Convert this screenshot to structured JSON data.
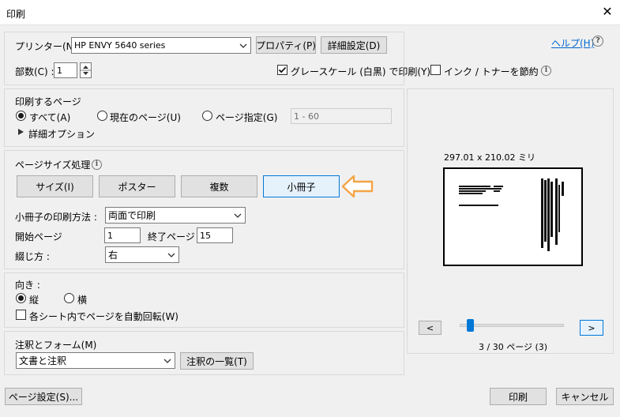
{
  "window": {
    "title": "印刷",
    "close_glyph": "✕"
  },
  "printer": {
    "label": "プリンター(N) :",
    "selected": "HP ENVY 5640 series",
    "properties_button": "プロパティ(P)",
    "advanced_button": "詳細設定(D)",
    "help_link": "ヘルプ(H)"
  },
  "copies": {
    "label": "部数(C) :",
    "value": "1"
  },
  "options": {
    "grayscale_label": "グレースケール (白黒) で印刷(Y)",
    "grayscale_checked": true,
    "ink_save_label": "インク / トナーを節約",
    "ink_save_checked": false
  },
  "pages_to_print": {
    "heading": "印刷するページ",
    "all_label": "すべて(A)",
    "current_label": "現在のページ(U)",
    "range_label": "ページ指定(G)",
    "range_placeholder": "1 - 60",
    "selected": "all",
    "more_options": "詳細オプション"
  },
  "page_sizing": {
    "heading": "ページサイズ処理",
    "tabs": [
      {
        "label": "サイズ(I)"
      },
      {
        "label": "ポスター"
      },
      {
        "label": "複数"
      },
      {
        "label": "小冊子"
      }
    ],
    "selected_tab": "小冊子",
    "booklet_method_label": "小冊子の印刷方法 :",
    "booklet_method_value": "両面で印刷",
    "start_page_label": "開始ページ",
    "start_page_value": "1",
    "end_page_label": "終了ページ",
    "end_page_value": "15",
    "binding_label": "綴じ方 :",
    "binding_value": "右"
  },
  "orientation": {
    "heading": "向き :",
    "portrait_label": "縦",
    "landscape_label": "横",
    "selected": "portrait",
    "auto_rotate_label": "各シート内でページを自動回転(W)",
    "auto_rotate_checked": false
  },
  "annotations": {
    "heading": "注釈とフォーム(M)",
    "value": "文書と注釈",
    "summary_button": "注釈の一覧(T)"
  },
  "preview": {
    "dimensions": "297.01 x 210.02 ミリ",
    "prev_button": "<",
    "next_button": ">",
    "page_status": "3 / 30 ページ (3)",
    "slider_fraction": 0.07
  },
  "footer": {
    "page_setup_button": "ページ設定(S)...",
    "print_button": "印刷",
    "cancel_button": "キャンセル"
  },
  "colors": {
    "accent": "#0078d7",
    "arrow": "#f4a446",
    "link": "#0066cc"
  }
}
